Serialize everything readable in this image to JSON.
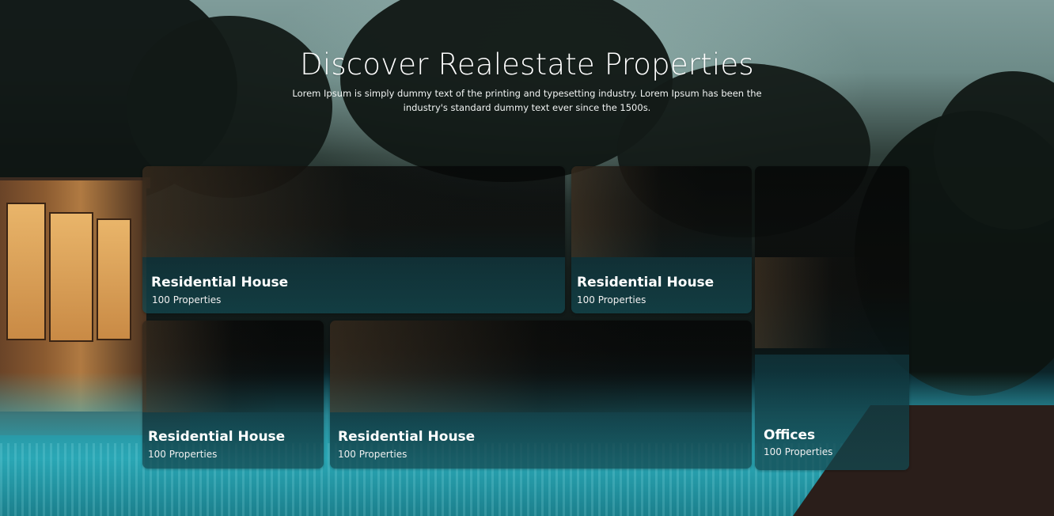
{
  "hero": {
    "title": "Discover Realestate Properties",
    "description": "Lorem Ipsum is simply dummy text of the printing and typesetting industry. Lorem Ipsum has been the industry's standard dummy text ever since the 1500s."
  },
  "cards": [
    {
      "title": "Residential House",
      "count": "100 Properties"
    },
    {
      "title": "Residential House",
      "count": "100 Properties"
    },
    {
      "title": "Offices",
      "count": "100 Properties"
    },
    {
      "title": "Residential House",
      "count": "100 Properties"
    },
    {
      "title": "Residential House",
      "count": "100 Properties"
    }
  ]
}
